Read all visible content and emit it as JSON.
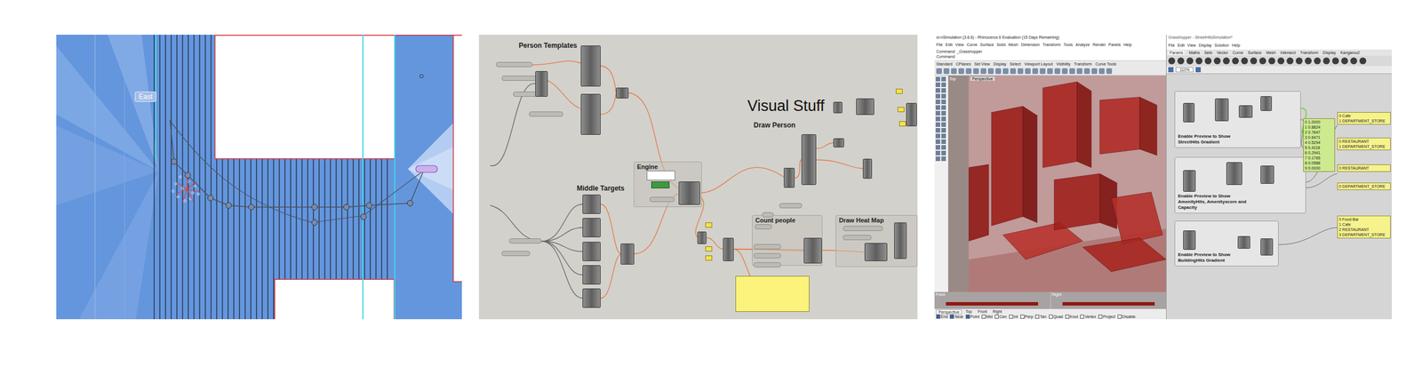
{
  "plan_view": {
    "start_label": "East"
  },
  "gh_canvas": {
    "groups": [
      {
        "label": "Person Templates",
        "kind": "label"
      },
      {
        "label": "Middle Targets",
        "kind": "label"
      },
      {
        "label": "Engine",
        "kind": "group"
      },
      {
        "label": "Visual Stuff",
        "kind": "title"
      },
      {
        "label": "Draw Person",
        "kind": "label"
      },
      {
        "label": "Count people",
        "kind": "group"
      },
      {
        "label": "Draw Heat Map",
        "kind": "group"
      }
    ]
  },
  "rhino": {
    "title": "ol-nSimulation (3.6.6) - Rhinoceros 6 Evaluation (15 Days Remaining)",
    "menu": [
      "File",
      "Edit",
      "View",
      "Curve",
      "Surface",
      "Solid",
      "Mesh",
      "Dimension",
      "Transform",
      "Tools",
      "Analyze",
      "Render",
      "Panels",
      "Help"
    ],
    "command_lines": [
      "Command: _Grasshopper",
      "Command:"
    ],
    "toolbar_tabs": [
      "Standard",
      "CPlanes",
      "Set View",
      "Display",
      "Select",
      "Viewport Layout",
      "Visibility",
      "Transform",
      "Curve Tools"
    ],
    "viewport": {
      "label": "Perspective",
      "side_label": "Top"
    },
    "mini_viewports": [
      "Front",
      "Right"
    ],
    "status_tabs": [
      {
        "label": "Perspective",
        "selected": true
      },
      {
        "label": "Top",
        "selected": false
      },
      {
        "label": "Front",
        "selected": false
      },
      {
        "label": "Right",
        "selected": false
      }
    ],
    "osnaps": [
      {
        "label": "End",
        "checked": true
      },
      {
        "label": "Near",
        "checked": true
      },
      {
        "label": "Point",
        "checked": true
      },
      {
        "label": "Mid",
        "checked": false
      },
      {
        "label": "Cen",
        "checked": false
      },
      {
        "label": "Int",
        "checked": false
      },
      {
        "label": "Perp",
        "checked": false
      },
      {
        "label": "Tan",
        "checked": false
      },
      {
        "label": "Quad",
        "checked": false
      },
      {
        "label": "Knot",
        "checked": false
      },
      {
        "label": "Vertex",
        "checked": false
      },
      {
        "label": "Project",
        "checked": false
      },
      {
        "label": "Disable",
        "checked": false
      }
    ]
  },
  "grasshopper": {
    "title": "Grasshopper - StreetHitsSimulation*",
    "menu": [
      "File",
      "Edit",
      "View",
      "Display",
      "Solution",
      "Help"
    ],
    "tabs": [
      {
        "label": "Params",
        "selected": true
      },
      {
        "label": "Maths",
        "selected": false
      },
      {
        "label": "Sets",
        "selected": false
      },
      {
        "label": "Vector",
        "selected": false
      },
      {
        "label": "Curve",
        "selected": false
      },
      {
        "label": "Surface",
        "selected": false
      },
      {
        "label": "Mesh",
        "selected": false
      },
      {
        "label": "Intersect",
        "selected": false
      },
      {
        "label": "Transform",
        "selected": false
      },
      {
        "label": "Display",
        "selected": false
      },
      {
        "label": "Kangaroo2",
        "selected": false
      }
    ],
    "zoom": "110%",
    "groups": [
      {
        "label": "Enable Preview to Show StreetHits Gradient"
      },
      {
        "label": "Enable Preview to Show AmenityHits, Amenityscore and Capacity"
      },
      {
        "label": "Enable Preview to Show BuildingHits Gradient"
      }
    ],
    "panels": [
      {
        "highlighted": true,
        "lines": [
          "0 1.0000",
          "1 0.8824",
          "2 0.7647",
          "3 0.6471",
          "4 0.5294",
          "5 0.4118",
          "6 0.2941",
          "7 0.1765",
          "8 0.0588",
          "9 0.0000"
        ]
      },
      {
        "highlighted": false,
        "lines": [
          "0 Cafe",
          "1 DEPARTMENT_STORE"
        ]
      },
      {
        "highlighted": false,
        "lines": [
          "0 RESTAURANT",
          "1 DEPARTMENT_STORE"
        ]
      },
      {
        "highlighted": false,
        "lines": [
          "0 RESTAURANT"
        ]
      },
      {
        "highlighted": false,
        "lines": [
          "0 DEPARTMENT_STORE"
        ]
      },
      {
        "highlighted": false,
        "lines": [
          "0 Food Bar",
          "1 Cafe",
          "2 RESTAURANT",
          "3 DEPARTMENT_STORE"
        ]
      }
    ]
  }
}
